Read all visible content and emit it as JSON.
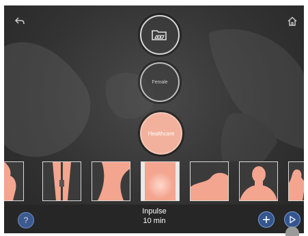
{
  "nav": {
    "back_icon": "back-arrow-icon",
    "home_icon": "home-icon"
  },
  "menu": {
    "folder_icon": "folder-icon",
    "female_label": "Female",
    "healthcare_label": "Healthcare"
  },
  "thumbnails": [
    {
      "icon": "body-silhouette-icon",
      "name": "body-pose"
    },
    {
      "icon": "zipper-icon",
      "name": "zipper"
    },
    {
      "icon": "waist-icon",
      "name": "waist"
    },
    {
      "icon": "abdomen-icon",
      "name": "abdomen"
    },
    {
      "icon": "reclining-body-icon",
      "name": "reclining"
    },
    {
      "icon": "head-shoulders-icon",
      "name": "head-shoulders"
    },
    {
      "icon": "partial-figure-icon",
      "name": "partial"
    }
  ],
  "bottom_bar": {
    "help_label": "?",
    "program_name": "Inpulse",
    "program_time": "10 min",
    "add_icon": "plus-icon",
    "play_icon": "play-icon"
  },
  "colors": {
    "accent_skin": "#f2b19d",
    "button_blue": "#35558f",
    "bar_bg": "#262626"
  }
}
